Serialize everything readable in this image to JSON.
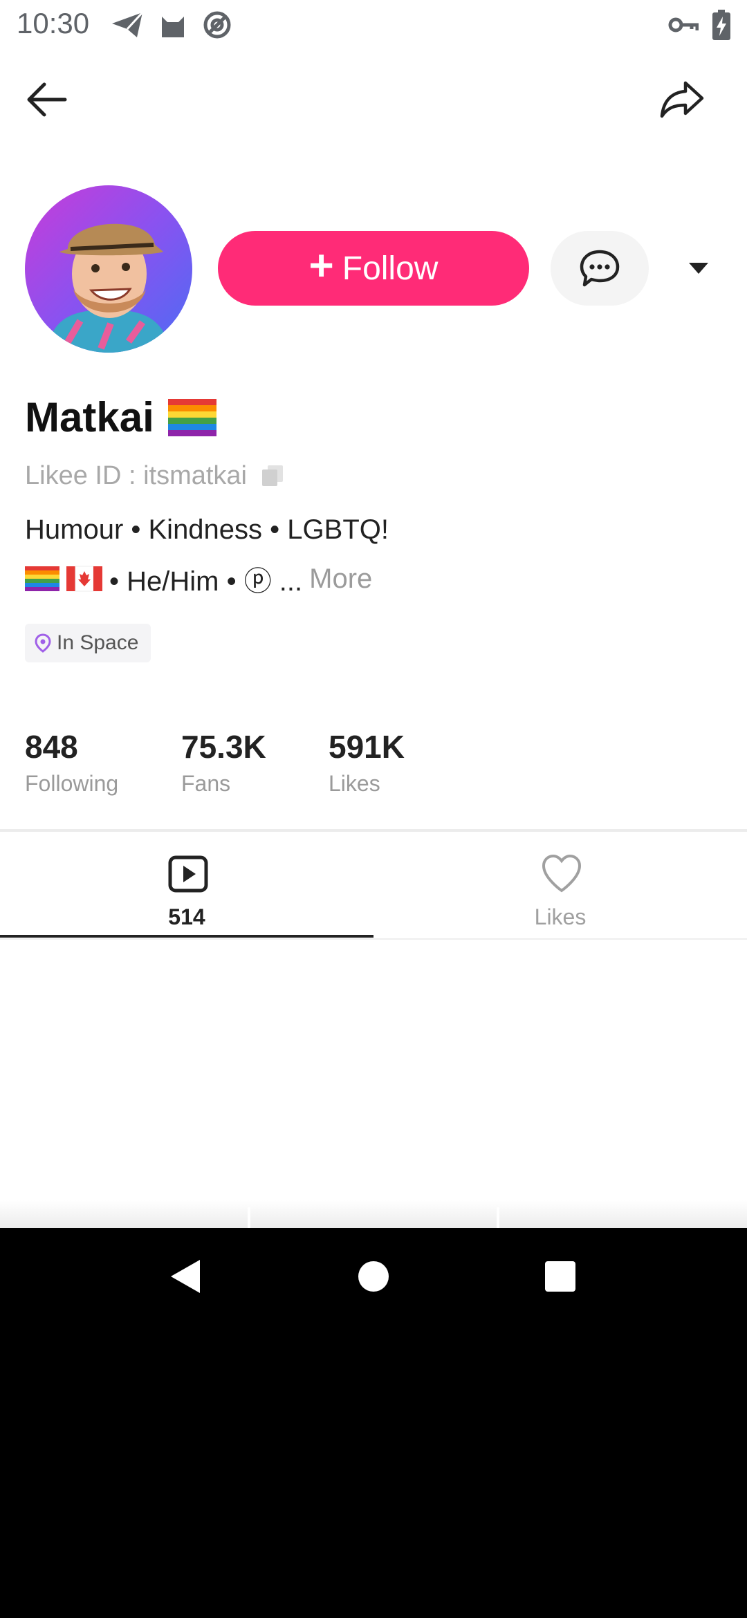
{
  "status_bar": {
    "time": "10:30"
  },
  "profile": {
    "name": "Matkai",
    "name_flag": "rainbow-flag",
    "likee_id": "Likee ID : itsmatkai",
    "bio_line1": "Humour • Kindness • LGBTQ!",
    "bio_line2_text": "• He/Him • ⓟ ...",
    "bio_more": "More",
    "location": "In Space"
  },
  "actions": {
    "follow_label": "Follow"
  },
  "stats": [
    {
      "value": "848",
      "label": "Following"
    },
    {
      "value": "75.3K",
      "label": "Fans"
    },
    {
      "value": "591K",
      "label": "Likes"
    }
  ],
  "tabs": [
    {
      "label": "514",
      "icon": "play-icon",
      "active": true
    },
    {
      "label": "Likes",
      "icon": "heart-icon",
      "active": false
    }
  ],
  "colors": {
    "accent": "#ff2b77",
    "location_pin": "#a060e8"
  }
}
